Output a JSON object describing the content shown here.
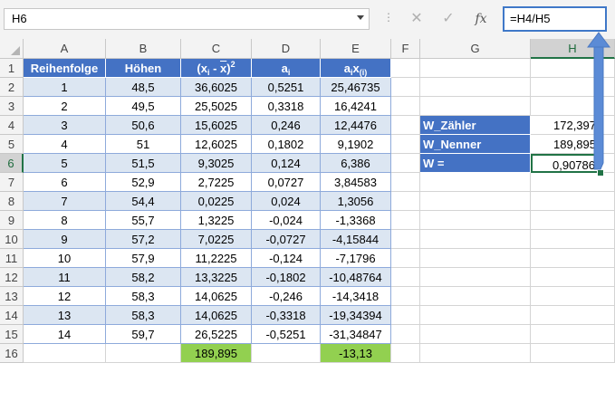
{
  "formula_bar": {
    "name_box": "H6",
    "cancel_icon": "✕",
    "enter_icon": "✓",
    "fx_label": "fx",
    "formula": "=H4/H5"
  },
  "columns": [
    "A",
    "B",
    "C",
    "D",
    "E",
    "F",
    "G",
    "H"
  ],
  "rows": [
    "1",
    "2",
    "3",
    "4",
    "5",
    "6",
    "7",
    "8",
    "9",
    "10",
    "11",
    "12",
    "13",
    "14",
    "15",
    "16"
  ],
  "table": {
    "headers": {
      "a": "Reihenfolge",
      "b": "Höhen",
      "c_pre": "(x",
      "c_sub": "i",
      "c_mid": " - ",
      "c_bar": "x",
      "c_post": ")",
      "c_sup": "2",
      "d_pre": "a",
      "d_sub": "i",
      "e_pre": "a",
      "e_sub1": "i",
      "e_mid": "x",
      "e_sub2": "(i)"
    },
    "rows": [
      [
        "1",
        "48,5",
        "36,6025",
        "0,5251",
        "25,46735"
      ],
      [
        "2",
        "49,5",
        "25,5025",
        "0,3318",
        "16,4241"
      ],
      [
        "3",
        "50,6",
        "15,6025",
        "0,246",
        "12,4476"
      ],
      [
        "4",
        "51",
        "12,6025",
        "0,1802",
        "9,1902"
      ],
      [
        "5",
        "51,5",
        "9,3025",
        "0,124",
        "6,386"
      ],
      [
        "6",
        "52,9",
        "2,7225",
        "0,0727",
        "3,84583"
      ],
      [
        "7",
        "54,4",
        "0,0225",
        "0,024",
        "1,3056"
      ],
      [
        "8",
        "55,7",
        "1,3225",
        "-0,024",
        "-1,3368"
      ],
      [
        "9",
        "57,2",
        "7,0225",
        "-0,0727",
        "-4,15844"
      ],
      [
        "10",
        "57,9",
        "11,2225",
        "-0,124",
        "-7,1796"
      ],
      [
        "11",
        "58,2",
        "13,3225",
        "-0,1802",
        "-10,48764"
      ],
      [
        "12",
        "58,3",
        "14,0625",
        "-0,246",
        "-14,3418"
      ],
      [
        "13",
        "58,3",
        "14,0625",
        "-0,3318",
        "-19,34394"
      ],
      [
        "14",
        "59,7",
        "26,5225",
        "-0,5251",
        "-31,34847"
      ]
    ],
    "sum_c": "189,895",
    "sum_e": "-13,13"
  },
  "w_table": [
    {
      "label": "W_Zähler",
      "value": "172,397"
    },
    {
      "label": "W_Nenner",
      "value": "189,895"
    },
    {
      "label": "W =",
      "value": "0,90786"
    }
  ],
  "colors": {
    "header_blue": "#4472c4",
    "band_blue": "#dce6f2",
    "sum_green": "#92d050",
    "select_green": "#217346",
    "arrow_blue": "#5b8bd6"
  }
}
